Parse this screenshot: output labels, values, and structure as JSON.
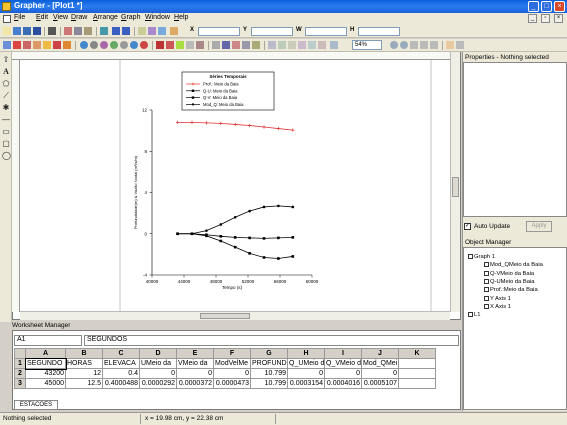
{
  "window": {
    "title": "Grapher - [Plot1 *]"
  },
  "menu": [
    {
      "label": "File",
      "u": "F",
      "rest": "ile"
    },
    {
      "label": "Edit",
      "u": "E",
      "rest": "dit"
    },
    {
      "label": "View",
      "u": "V",
      "rest": "iew"
    },
    {
      "label": "Draw",
      "u": "D",
      "rest": "raw"
    },
    {
      "label": "Arrange",
      "u": "A",
      "rest": "rrange"
    },
    {
      "label": "Graph",
      "u": "G",
      "rest": "raph"
    },
    {
      "label": "Window",
      "u": "W",
      "rest": "indow"
    },
    {
      "label": "Help",
      "u": "H",
      "rest": "elp"
    }
  ],
  "toolbar": {
    "coord_labels": [
      "X",
      "Y",
      "W",
      "H"
    ],
    "zoom_value": "54%"
  },
  "chart_data": {
    "type": "line",
    "legend_title": "Séries Temporais",
    "legend": [
      {
        "name": "Prof.: Meio da Baia",
        "color": "#e03030",
        "marker": "plus"
      },
      {
        "name": "Q-U: Meio da Baia",
        "color": "#000000",
        "marker": "square"
      },
      {
        "name": "Q-V: Meio da Baia",
        "color": "#000000",
        "marker": "square"
      },
      {
        "name": "Mod_Q: Meio da Baia",
        "color": "#000000",
        "marker": "dot"
      }
    ],
    "xlabel": "Tempo (s)",
    "ylabel": "Profundidade(m) & Vazão Nodal (m³/s/m)",
    "xlim": [
      40000,
      60000
    ],
    "ylim": [
      -4,
      12
    ],
    "xticks": [
      40000,
      44000,
      48000,
      52000,
      56000,
      60000
    ],
    "yticks": [
      -4,
      0,
      4,
      8,
      12
    ],
    "series": [
      {
        "name": "Prof.: Meio da Baia",
        "color": "#e03030",
        "marker": "plus",
        "x": [
          43200,
          45000,
          46800,
          48600,
          50400,
          52200,
          54000,
          55800,
          57600
        ],
        "y": [
          10.8,
          10.8,
          10.75,
          10.7,
          10.6,
          10.5,
          10.35,
          10.2,
          10.05
        ]
      },
      {
        "name": "Q-U: Meio da Baia",
        "color": "#000000",
        "marker": "square",
        "x": [
          43200,
          45000,
          46800,
          48600,
          50400,
          52200,
          54000,
          55800,
          57600
        ],
        "y": [
          0,
          0,
          -0.1,
          -0.25,
          -0.35,
          -0.4,
          -0.45,
          -0.4,
          -0.35
        ]
      },
      {
        "name": "Q-V: Meio da Baia",
        "color": "#000000",
        "marker": "square",
        "x": [
          43200,
          45000,
          46800,
          48600,
          50400,
          52200,
          54000,
          55800,
          57600
        ],
        "y": [
          0,
          0,
          -0.2,
          -0.7,
          -1.3,
          -1.9,
          -2.3,
          -2.4,
          -2.2
        ]
      },
      {
        "name": "Mod_Q: Meio da Baia",
        "color": "#000000",
        "marker": "dot",
        "x": [
          43200,
          45000,
          46800,
          48600,
          50400,
          52200,
          54000,
          55800,
          57600
        ],
        "y": [
          0,
          0,
          0.3,
          0.9,
          1.6,
          2.2,
          2.6,
          2.7,
          2.6
        ]
      }
    ]
  },
  "properties": {
    "title": "Properties - Nothing selected",
    "auto_update": "Auto Update",
    "apply": "Apply"
  },
  "object_manager": {
    "title": "Object Manager",
    "items": [
      {
        "label": "Graph 1",
        "indent": 0
      },
      {
        "label": "Mod_QMeio da Baia",
        "indent": 1
      },
      {
        "label": "Q-VMeio da Baia",
        "indent": 1
      },
      {
        "label": "Q-UMeio da Baia",
        "indent": 1
      },
      {
        "label": "Prof.:Meio da Baia",
        "indent": 1
      },
      {
        "label": "Y Axis 1",
        "indent": 1
      },
      {
        "label": "X Axis 1",
        "indent": 1
      },
      {
        "label": "L1",
        "indent": 0
      }
    ]
  },
  "worksheet": {
    "title": "Worksheet Manager",
    "cell_ref": "A1",
    "cell_value": "SEGUNDOS",
    "columns": [
      "A",
      "B",
      "C",
      "D",
      "E",
      "F",
      "G",
      "H",
      "I",
      "J",
      "K"
    ],
    "rows": [
      {
        "num": "1",
        "cells": [
          "SEGUNDO",
          "HORAS",
          "ELEVACA",
          "UMeio da",
          "VMeio da",
          "ModVelMe",
          "PROFUND",
          "Q_UMeio d",
          "Q_VMeio d",
          "Mod_QMei",
          ""
        ]
      },
      {
        "num": "2",
        "cells": [
          "43200",
          "12",
          "0.4",
          "0",
          "0",
          "0",
          "10.799",
          "0",
          "0",
          "0",
          ""
        ]
      },
      {
        "num": "3",
        "cells": [
          "45000",
          "12.5",
          "0.4000488",
          "0.0000292",
          "0.0000372",
          "0.0000473",
          "10.799",
          "0.0003154",
          "0.0004016",
          "0.0005107",
          ""
        ]
      }
    ],
    "sheet_tab": "ESTACOES"
  },
  "status": {
    "left": "Nothing selected",
    "coords": "x = 19.98 cm, y = 22.38 cm"
  }
}
